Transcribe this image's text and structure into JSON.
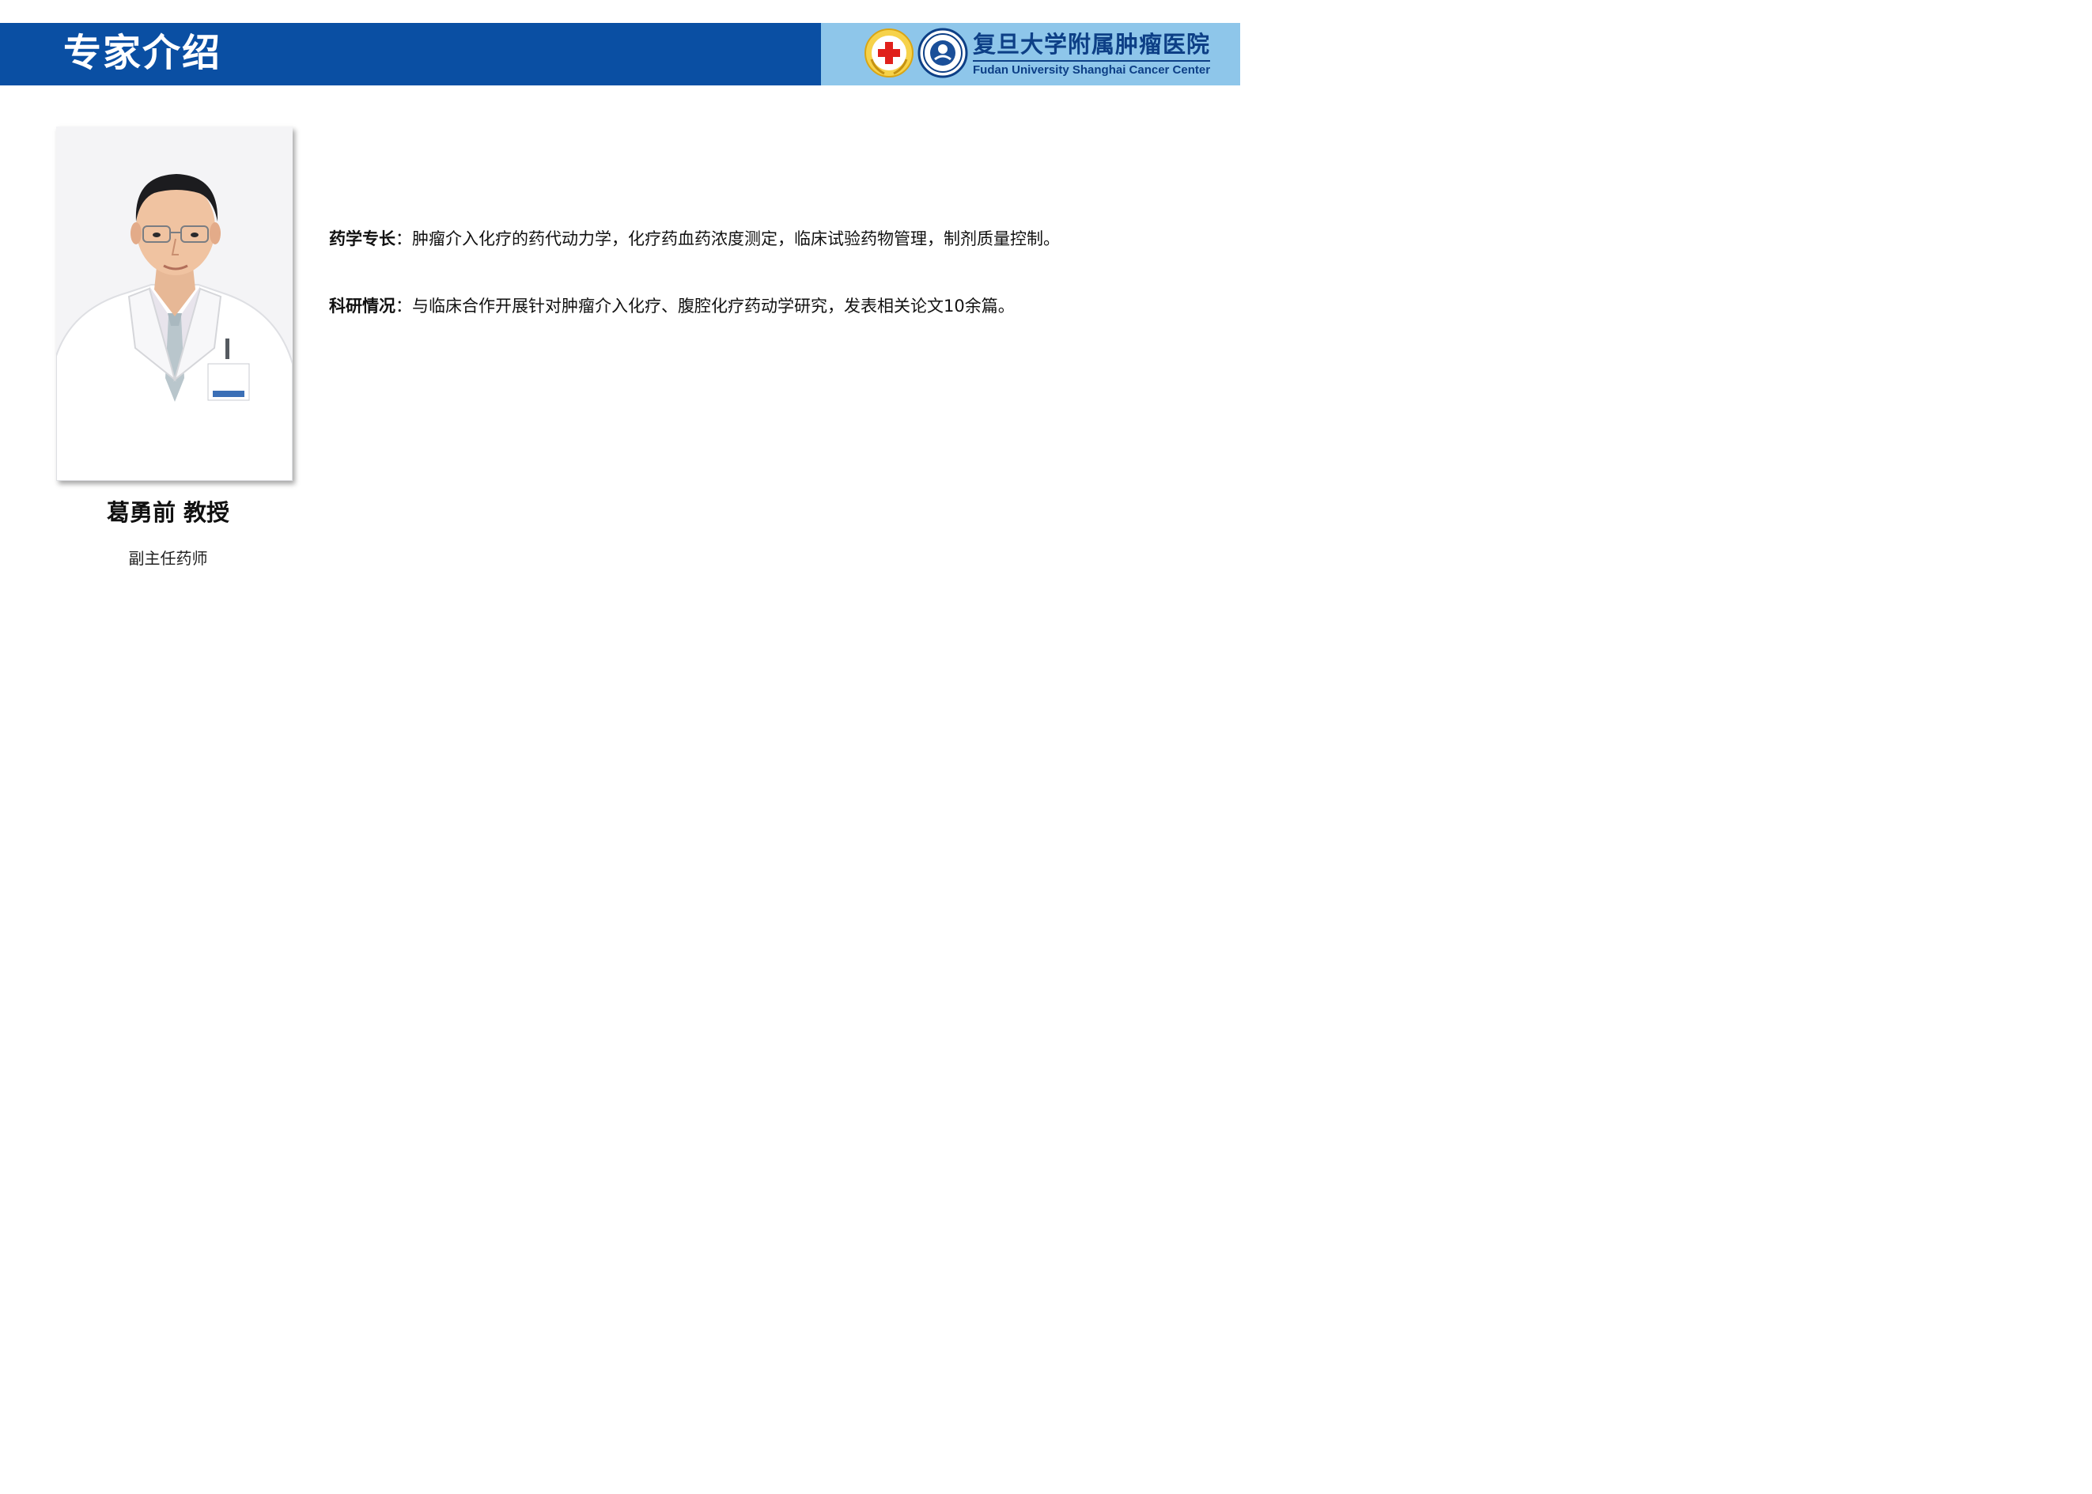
{
  "header": {
    "title": "专家介绍",
    "colors": {
      "primary": "#0a4fa3",
      "secondary": "#8ec6ea"
    }
  },
  "logo": {
    "icons": [
      "red-cross-emblem-icon",
      "school-emblem-icon"
    ],
    "name_cn": "复旦大学附属肿瘤医院",
    "name_en": "Fudan University Shanghai Cancer Center"
  },
  "expert": {
    "name": "葛勇前 教授",
    "title": "副主任药师"
  },
  "bio": {
    "specialty_label": "药学专长",
    "specialty_text": "：肿瘤介入化疗的药代动力学，化疗药血药浓度测定，临床试验药物管理，制剂质量控制。",
    "research_label": "科研情况",
    "research_text": "：与临床合作开展针对肿瘤介入化疗、腹腔化疗药动学研究，发表相关论文10余篇。"
  }
}
